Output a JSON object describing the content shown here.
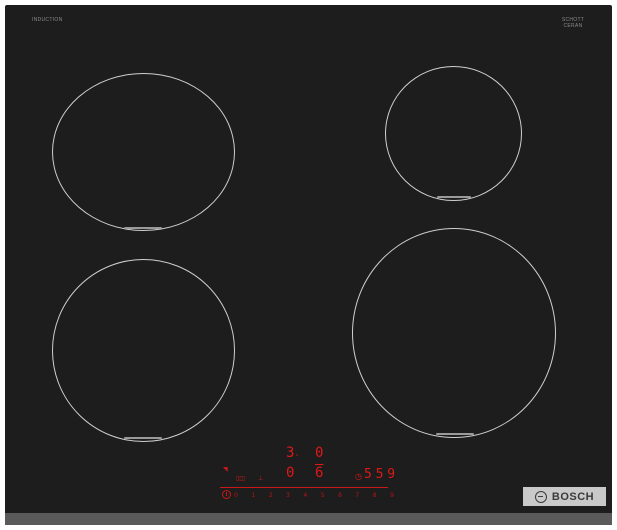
{
  "brand": {
    "top_left_label": "INDUCTION",
    "top_left_sub": "",
    "top_right_label": "SCHOTT CERAN",
    "top_right_sub": ""
  },
  "displays": {
    "zone_rear_left": "3",
    "zone_rear_left_sub": "ˢ",
    "zone_rear_right": "0",
    "zone_front_left": "0",
    "zone_front_right": "6",
    "timer": "5 5 9"
  },
  "icons": {
    "timer": "clock-icon",
    "wifi": "wifi-icon",
    "lock": "lock-icon",
    "power": "power-icon",
    "bosch_logo": "bosch-armature-icon"
  },
  "slider": {
    "levels": [
      "0",
      "1",
      "2",
      "3",
      "4",
      "5",
      "6",
      "7",
      "8",
      "9"
    ]
  },
  "logo": {
    "text": "BOSCH"
  },
  "colors": {
    "glass": "#1d1d1d",
    "display_red": "#e01818",
    "zone_outline": "#cfcfcf",
    "logo_bg": "#c9c9c9"
  }
}
